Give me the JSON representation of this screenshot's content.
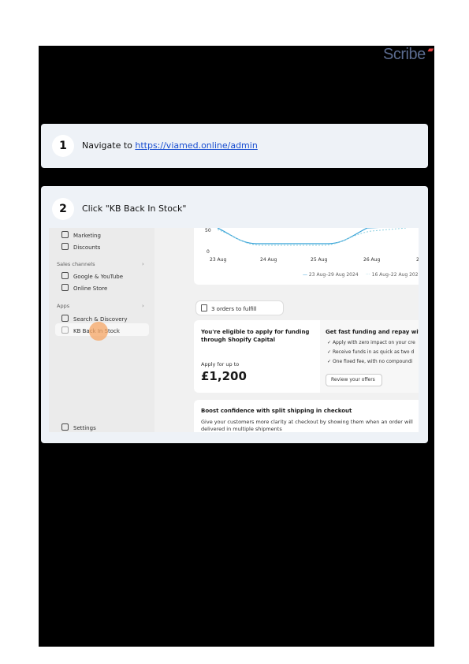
{
  "brand": {
    "logo_text": "Scribe",
    "accent": "#5b6b8f"
  },
  "steps": [
    {
      "number": "1",
      "text_prefix": "Navigate to ",
      "link": "https://viamed.online/admin"
    },
    {
      "number": "2",
      "text": "Click \"KB Back In Stock\""
    }
  ],
  "screenshot": {
    "sidebar": {
      "items_top": [
        "Marketing",
        "Discounts"
      ],
      "sales_channels_label": "Sales channels",
      "sales_channels": [
        "Google & YouTube",
        "Online Store"
      ],
      "apps_label": "Apps",
      "apps": [
        "Search & Discovery",
        "KB Back In Stock"
      ],
      "settings": "Settings"
    },
    "chart": {
      "y_ticks": [
        "50",
        "0"
      ],
      "x_ticks": [
        "23 Aug",
        "24 Aug",
        "25 Aug",
        "26 Aug",
        "2"
      ],
      "legend_current": "23 Aug–29 Aug 2024",
      "legend_previous": "16 Aug–22 Aug 202"
    },
    "orders_pill": "3 orders to fulfill",
    "capital": {
      "title_line1": "You're eligible to apply for funding",
      "title_line2": "through Shopify Capital",
      "apply_label": "Apply for up to",
      "amount": "£1,200",
      "right_title": "Get fast funding and repay with",
      "bullets": [
        "Apply with zero impact on your cre",
        "Receive funds in as quick as two d",
        "One fixed fee, with no compoundi"
      ],
      "review_button": "Review your offers"
    },
    "split": {
      "title": "Boost confidence with split shipping in checkout",
      "line1": "Give your customers more clarity at checkout by showing them when an order will",
      "line2": "delivered in multiple shipments"
    }
  }
}
